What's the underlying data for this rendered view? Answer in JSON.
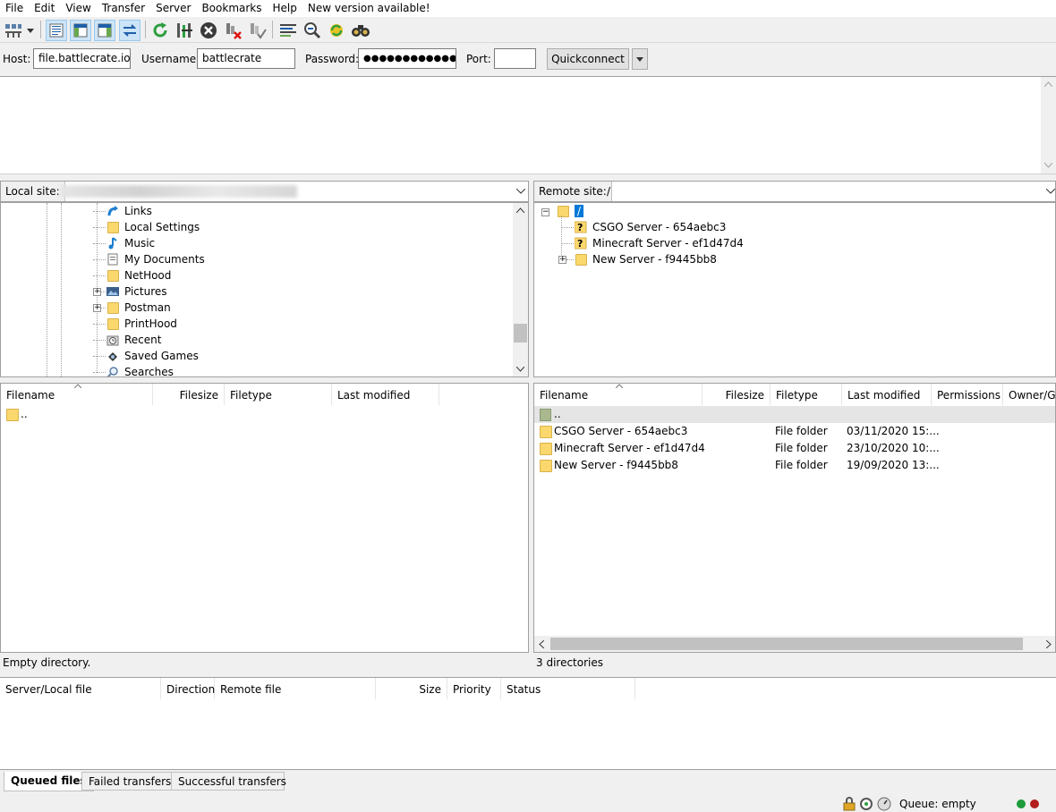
{
  "menu": [
    "File",
    "Edit",
    "View",
    "Transfer",
    "Server",
    "Bookmarks",
    "Help",
    "New version available!"
  ],
  "toolbar_icons": [
    "site-manager-icon",
    "dropdown-arrow-icon",
    "toggle-log-icon",
    "toggle-local-tree-icon",
    "toggle-remote-tree-icon",
    "toggle-queue-icon",
    "refresh-icon",
    "process-queue-icon",
    "cancel-icon",
    "disconnect-icon",
    "reconnect-icon",
    "directory-listing-filters-icon",
    "compare-icon",
    "sync-browse-icon",
    "search-remote-icon"
  ],
  "quickconnect": {
    "host_label": "Host:",
    "host_value": "file.battlecrate.io",
    "username_label": "Username:",
    "username_value": "battlecrate",
    "password_label": "Password:",
    "password_value": "●●●●●●●●●●●●●●",
    "port_label": "Port:",
    "port_value": "",
    "button_label": "Quickconnect"
  },
  "local": {
    "site_label": "Local site:",
    "tree": [
      "Links",
      "Local Settings",
      "Music",
      "My Documents",
      "NetHood",
      "Pictures",
      "Postman",
      "PrintHood",
      "Recent",
      "Saved Games",
      "Searches"
    ],
    "columns": [
      "Filename",
      "Filesize",
      "Filetype",
      "Last modified"
    ],
    "rows": [
      ".."
    ],
    "status": "Empty directory."
  },
  "remote": {
    "site_label": "Remote site:",
    "site_path": "/",
    "tree_root": "/",
    "tree": [
      "CSGO Server - 654aebc3",
      "Minecraft Server - ef1d47d4",
      "New Server - f9445bb8"
    ],
    "columns": [
      "Filename",
      "Filesize",
      "Filetype",
      "Last modified",
      "Permissions",
      "Owner/Gro"
    ],
    "parent_row": "..",
    "rows": [
      {
        "name": "CSGO Server - 654aebc3",
        "type": "File folder",
        "modified": "03/11/2020 15:..."
      },
      {
        "name": "Minecraft Server - ef1d47d4",
        "type": "File folder",
        "modified": "23/10/2020 10:..."
      },
      {
        "name": "New Server - f9445bb8",
        "type": "File folder",
        "modified": "19/09/2020 13:..."
      }
    ],
    "status": "3 directories"
  },
  "queue": {
    "columns": [
      "Server/Local file",
      "Direction",
      "Remote file",
      "Size",
      "Priority",
      "Status"
    ],
    "tabs": [
      "Queued files",
      "Failed transfers",
      "Successful transfers"
    ],
    "active_tab": "Queued files"
  },
  "statusbar": {
    "queue": "Queue: empty"
  },
  "colors": {
    "folder": "#fbd86d",
    "selected_row": "#e5e5e5",
    "accent": "#0078d7"
  }
}
